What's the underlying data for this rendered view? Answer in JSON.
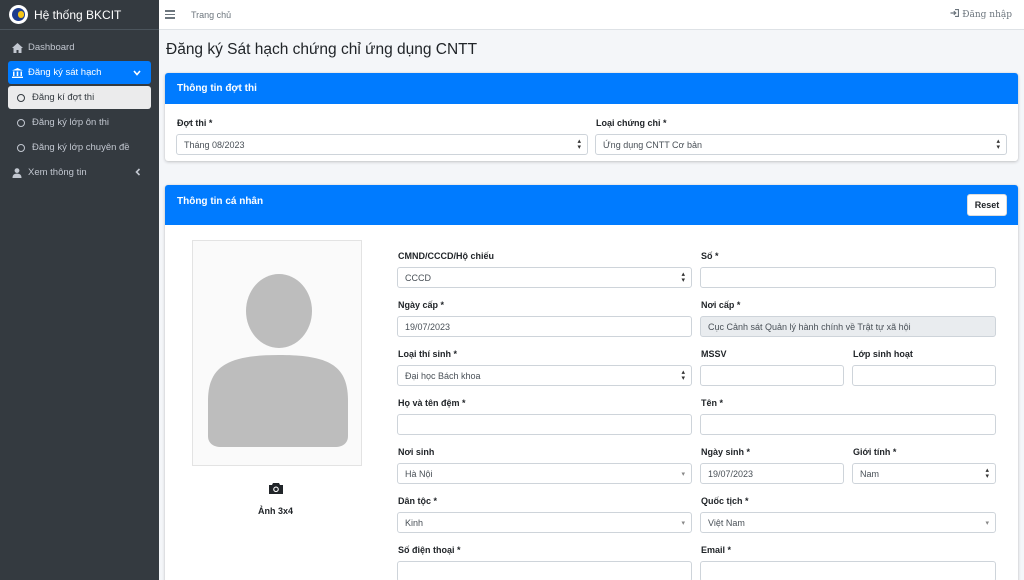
{
  "brand": {
    "name": "Hệ thống BKCIT"
  },
  "sidebar": {
    "items": [
      {
        "label": "Dashboard",
        "icon": "home-icon"
      },
      {
        "label": "Đăng ký sát hạch",
        "icon": "bank-icon"
      },
      {
        "label": "Đăng kí đợt thi",
        "icon": "circle-icon"
      },
      {
        "label": "Đăng ký lớp ôn thi",
        "icon": "circle-icon"
      },
      {
        "label": "Đăng ký lớp chuyên đề",
        "icon": "circle-icon"
      },
      {
        "label": "Xem thông tin",
        "icon": "user-icon"
      }
    ]
  },
  "topbar": {
    "home": "Trang chủ",
    "login": "Đăng nhập"
  },
  "page": {
    "title": "Đăng ký Sát hạch chứng chỉ ứng dụng CNTT"
  },
  "exam_card": {
    "title": "Thông tin đợt thi",
    "period_label": "Đợt thi *",
    "period_value": "Tháng 08/2023",
    "cert_label": "Loại chứng chỉ *",
    "cert_value": "Ứng dụng CNTT Cơ bản"
  },
  "personal_card": {
    "title": "Thông tin cá nhân",
    "reset": "Reset",
    "photo_label": "Ảnh 3x4",
    "id_type_label": "CMND/CCCD/Hộ chiếu",
    "id_type_value": "CCCD",
    "id_no_label": "Số *",
    "issue_date_label": "Ngày cấp *",
    "issue_date_value": "19/07/2023",
    "issue_place_label": "Nơi cấp *",
    "issue_place_value": "Cục Cảnh sát Quản lý hành chính về Trật tự xã hội",
    "candidate_type_label": "Loại thí sinh *",
    "candidate_type_value": "Đại học Bách khoa",
    "student_id_label": "MSSV",
    "class_label": "Lớp sinh hoạt",
    "lastname_label": "Họ và tên đệm *",
    "firstname_label": "Tên *",
    "birthplace_label": "Nơi sinh",
    "birthplace_value": "Hà Nội",
    "dob_label": "Ngày sinh *",
    "dob_value": "19/07/2023",
    "gender_label": "Giới tính *",
    "gender_value": "Nam",
    "ethnic_label": "Dân tộc *",
    "ethnic_value": "Kinh",
    "nationality_label": "Quốc tịch *",
    "nationality_value": "Việt Nam",
    "phone_label": "Số điện thoại *",
    "email_label": "Email *"
  },
  "colors": {
    "sidebar": "#343a40",
    "primary": "#007bff"
  }
}
